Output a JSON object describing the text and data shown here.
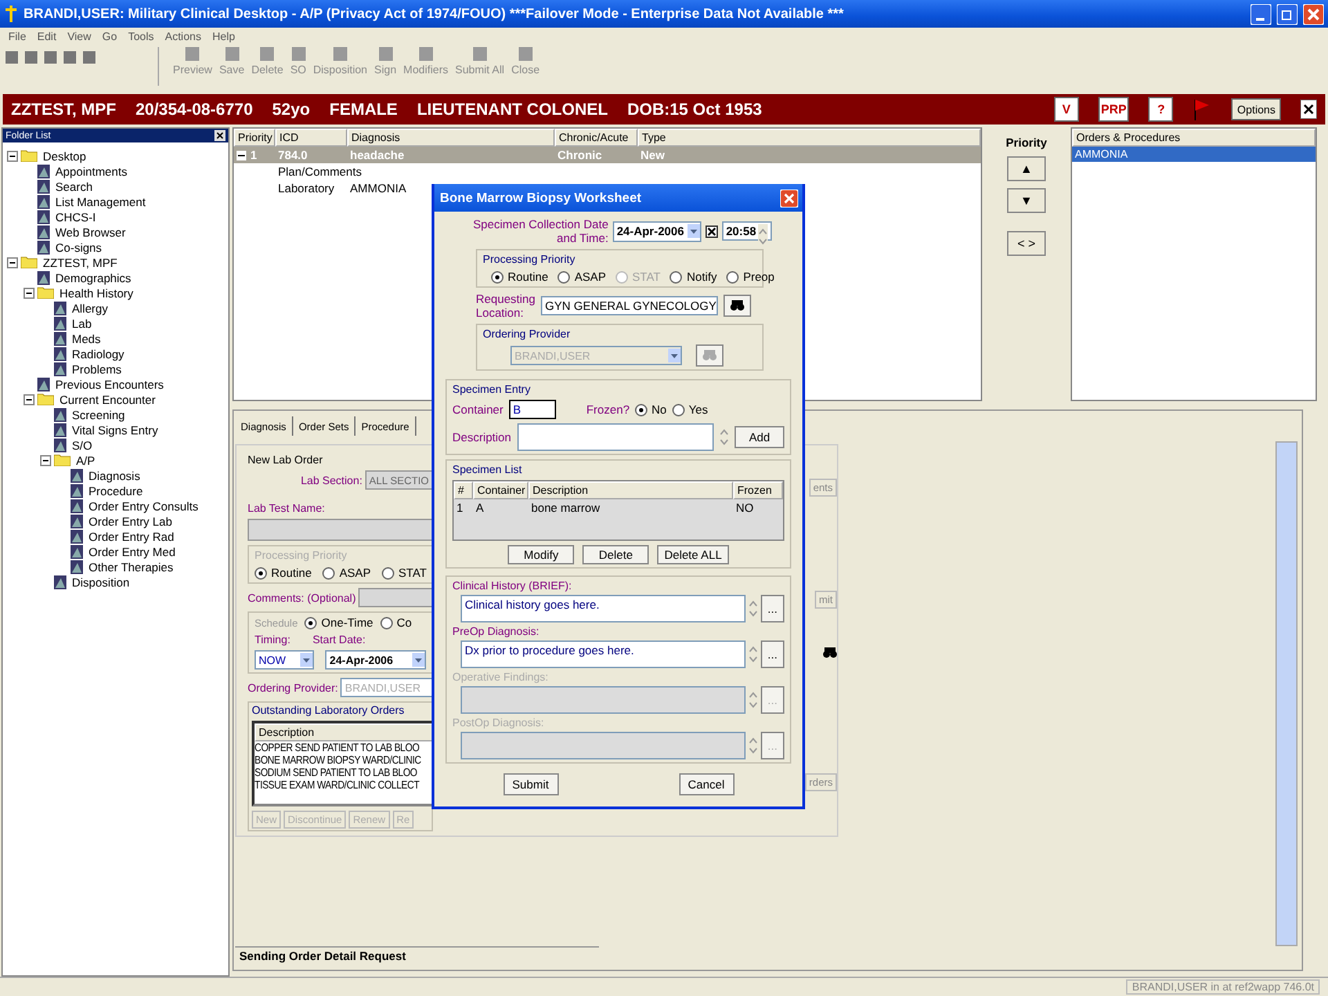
{
  "window": {
    "title": "BRANDI,USER: Military Clinical Desktop - A/P (Privacy Act of 1974/FOUO) ***Failover Mode - Enterprise Data Not Available ***"
  },
  "menu": [
    "File",
    "Edit",
    "View",
    "Go",
    "Tools",
    "Actions",
    "Help"
  ],
  "toolbar": [
    {
      "label": "Preview",
      "disabled": true
    },
    {
      "label": "Save",
      "disabled": true
    },
    {
      "label": "Delete",
      "disabled": true
    },
    {
      "label": "SO",
      "disabled": true
    },
    {
      "label": "Disposition",
      "disabled": true
    },
    {
      "label": "Sign",
      "disabled": true
    },
    {
      "label": "Modifiers",
      "disabled": true
    },
    {
      "label": "Submit All",
      "disabled": true
    },
    {
      "label": "Close",
      "disabled": true
    }
  ],
  "patient": {
    "items": [
      "ZZTEST, MPF",
      "20/354-08-6770",
      "52yo",
      "FEMALE",
      "LIEUTENANT COLONEL",
      "DOB:15 Oct 1953"
    ],
    "badges": [
      "V",
      "PRP",
      "?"
    ],
    "options": "Options"
  },
  "folder_list": {
    "title": "Folder List",
    "tree": [
      {
        "label": "Desktop",
        "kind": "folder",
        "expanded": true,
        "children": [
          {
            "label": "Appointments",
            "kind": "item"
          },
          {
            "label": "Search",
            "kind": "item"
          },
          {
            "label": "List Management",
            "kind": "item"
          },
          {
            "label": "CHCS-I",
            "kind": "item"
          },
          {
            "label": "Web Browser",
            "kind": "item"
          },
          {
            "label": "Co-signs",
            "kind": "item"
          }
        ]
      },
      {
        "label": "ZZTEST, MPF",
        "kind": "folder",
        "expanded": true,
        "children": [
          {
            "label": "Demographics",
            "kind": "item"
          },
          {
            "label": "Health History",
            "kind": "folder",
            "expanded": true,
            "children": [
              {
                "label": "Allergy",
                "kind": "item"
              },
              {
                "label": "Lab",
                "kind": "item"
              },
              {
                "label": "Meds",
                "kind": "item"
              },
              {
                "label": "Radiology",
                "kind": "item"
              },
              {
                "label": "Problems",
                "kind": "item"
              }
            ]
          },
          {
            "label": "Previous Encounters",
            "kind": "item"
          },
          {
            "label": "Current Encounter",
            "kind": "folder",
            "expanded": true,
            "children": [
              {
                "label": "Screening",
                "kind": "item"
              },
              {
                "label": "Vital Signs Entry",
                "kind": "item"
              },
              {
                "label": "S/O",
                "kind": "item"
              },
              {
                "label": "A/P",
                "kind": "folder",
                "expanded": true,
                "children": [
                  {
                    "label": "Diagnosis",
                    "kind": "item"
                  },
                  {
                    "label": "Procedure",
                    "kind": "item"
                  },
                  {
                    "label": "Order Entry Consults",
                    "kind": "item"
                  },
                  {
                    "label": "Order Entry Lab",
                    "kind": "item"
                  },
                  {
                    "label": "Order Entry Rad",
                    "kind": "item"
                  },
                  {
                    "label": "Order Entry Med",
                    "kind": "item"
                  },
                  {
                    "label": "Other Therapies",
                    "kind": "item"
                  }
                ]
              },
              {
                "label": "Disposition",
                "kind": "item"
              }
            ]
          }
        ]
      }
    ]
  },
  "problems": {
    "columns": [
      "Priority",
      "ICD",
      "Diagnosis",
      "Chronic/Acute",
      "Type"
    ],
    "rows": [
      {
        "priority": "1",
        "icd": "784.0",
        "diagnosis": "headache",
        "chronicity": "Chronic",
        "type": "New",
        "selected": true,
        "expanded": true,
        "details": [
          {
            "label": "Plan/Comments"
          },
          {
            "label": "Laboratory",
            "value": "AMMONIA"
          }
        ]
      }
    ]
  },
  "priority": {
    "title": "Priority",
    "buttons": [
      "▲",
      "▼",
      "< >"
    ]
  },
  "orders": {
    "title": "Orders & Procedures",
    "items": [
      {
        "label": "AMMONIA",
        "selected": true
      }
    ]
  },
  "tabs": [
    {
      "label": "Diagnosis",
      "selected": false
    },
    {
      "label": "Order Sets",
      "selected": false
    },
    {
      "label": "Procedure",
      "selected": false
    }
  ],
  "lab_order": {
    "title": "New Lab Order",
    "section_label": "Lab Section:",
    "section_value": "ALL SECTIO",
    "test_label": "Lab Test Name:",
    "priority": {
      "title": "Processing Priority",
      "disabled": true,
      "options": [
        {
          "label": "Routine",
          "selected": true
        },
        {
          "label": "ASAP",
          "selected": false
        },
        {
          "label": "STAT",
          "selected": false
        }
      ]
    },
    "comments_label": "Comments: (Optional)",
    "comments_button": "ents",
    "submit_button": "mit",
    "schedule": {
      "title": "Schedule",
      "options": [
        {
          "label": "One-Time",
          "selected": true
        },
        {
          "label": "Co",
          "selected": false
        }
      ],
      "timing_label": "Timing:",
      "timing": "NOW",
      "start_label": "Start Date:",
      "start_date": "24-Apr-2006"
    },
    "provider_label": "Ordering Provider:",
    "provider": "BRANDI,USER",
    "outstanding": {
      "title": "Outstanding Laboratory Orders",
      "column": "Description",
      "rows": [
        "COPPER   SEND PATIENT TO LAB   BLOO",
        "BONE MARROW BIOPSY   WARD/CLINIC",
        "SODIUM   SEND PATIENT TO LAB   BLOO",
        "TISSUE EXAM   WARD/CLINIC COLLECT"
      ],
      "buttons": [
        {
          "label": "New",
          "disabled": true
        },
        {
          "label": "Discontinue",
          "disabled": true
        },
        {
          "label": "Renew",
          "disabled": true
        },
        {
          "label": "Re",
          "disabled": true
        }
      ],
      "end_button": "rders"
    }
  },
  "status_message": "Sending Order Detail Request",
  "status_bar": "BRANDI,USER in  at ref2wapp 746.0t",
  "dialog": {
    "title": "Bone Marrow Biopsy Worksheet",
    "collection": {
      "label_lines": [
        "Specimen Collection Date",
        "and Time:"
      ],
      "date": "24-Apr-2006",
      "time_enabled": true,
      "time": "20:58"
    },
    "priority": {
      "title": "Processing Priority",
      "options": [
        {
          "label": "Routine",
          "selected": true,
          "disabled": false
        },
        {
          "label": "ASAP",
          "selected": false,
          "disabled": false
        },
        {
          "label": "STAT",
          "selected": false,
          "disabled": true
        },
        {
          "label": "Notify",
          "selected": false,
          "disabled": false
        },
        {
          "label": "Preop",
          "selected": false,
          "disabled": false
        }
      ]
    },
    "location": {
      "label_lines": [
        "Requesting",
        "Location:"
      ],
      "value": "GYN GENERAL GYNECOLOGY"
    },
    "provider": {
      "title": "Ordering Provider",
      "value": "BRANDI,USER",
      "disabled": true
    },
    "entry": {
      "title": "Specimen Entry",
      "container_label": "Container",
      "container": "B",
      "frozen_label": "Frozen?",
      "frozen_options": [
        {
          "label": "No",
          "selected": true
        },
        {
          "label": "Yes",
          "selected": false
        }
      ],
      "description_label": "Description",
      "add": "Add"
    },
    "specimens": {
      "title": "Specimen List",
      "columns": [
        "#",
        "Container",
        "Description",
        "Frozen"
      ],
      "rows": [
        [
          "1",
          "A",
          "bone marrow",
          "NO"
        ]
      ],
      "buttons": [
        "Modify",
        "Delete",
        "Delete ALL"
      ]
    },
    "notes": [
      {
        "label": "Clinical History (BRIEF):",
        "value": "Clinical history goes here.",
        "disabled": false,
        "button": "..."
      },
      {
        "label": "PreOp Diagnosis:",
        "value": "Dx prior to procedure goes here.",
        "disabled": false,
        "button": "..."
      },
      {
        "label": "Operative Findings:",
        "disabled": true,
        "button": "..."
      },
      {
        "label": "PostOp Diagnosis:",
        "disabled": true,
        "button": "..."
      }
    ],
    "buttons": [
      "Submit",
      "Cancel"
    ]
  }
}
